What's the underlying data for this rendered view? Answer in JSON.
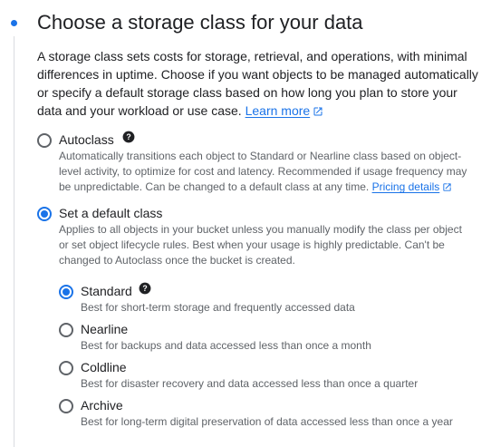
{
  "section": {
    "title": "Choose a storage class for your data",
    "intro": "A storage class sets costs for storage, retrieval, and operations, with minimal differences in uptime. Choose if you want objects to be managed automatically or specify a default storage class based on how long you plan to store your data and your workload or use case.",
    "learn_more": "Learn more"
  },
  "autoclass": {
    "label": "Autoclass",
    "checked": false,
    "description": "Automatically transitions each object to Standard or Nearline class based on object-level activity, to optimize for cost and latency. Recommended if usage frequency may be unpredictable. Can be changed to a default class at any time.",
    "pricing_link": "Pricing details"
  },
  "default_class": {
    "label": "Set a default class",
    "checked": true,
    "description": "Applies to all objects in your bucket unless you manually modify the class per object or set object lifecycle rules. Best when your usage is highly predictable. Can't be changed to Autoclass once the bucket is created."
  },
  "classes": [
    {
      "label": "Standard",
      "checked": true,
      "description": "Best for short-term storage and frequently accessed data"
    },
    {
      "label": "Nearline",
      "checked": false,
      "description": "Best for backups and data accessed less than once a month"
    },
    {
      "label": "Coldline",
      "checked": false,
      "description": "Best for disaster recovery and data accessed less than once a quarter"
    },
    {
      "label": "Archive",
      "checked": false,
      "description": "Best for long-term digital preservation of data accessed less than once a year"
    }
  ],
  "icons": {
    "help": "help-circle-icon",
    "external_link": "open-in-new-icon"
  },
  "colors": {
    "accent": "#1a73e8",
    "text": "#202124",
    "secondary_text": "#5f6368",
    "rail": "#dadce0"
  }
}
